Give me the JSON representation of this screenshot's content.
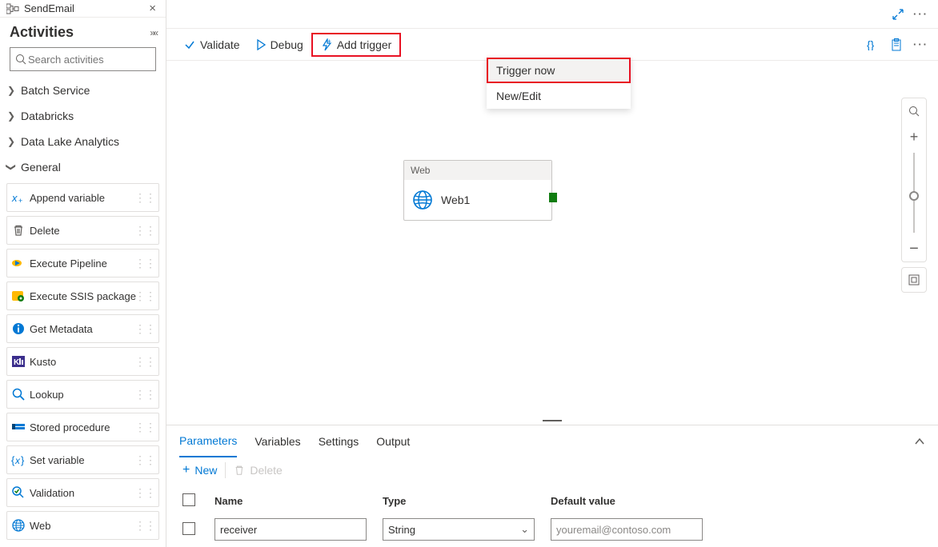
{
  "pipeline": {
    "name": "SendEmail"
  },
  "activities": {
    "title": "Activities",
    "search_placeholder": "Search activities",
    "categories": [
      {
        "label": "Batch Service",
        "expanded": false
      },
      {
        "label": "Databricks",
        "expanded": false
      },
      {
        "label": "Data Lake Analytics",
        "expanded": false
      },
      {
        "label": "General",
        "expanded": true
      }
    ],
    "general_items": [
      {
        "label": "Append variable",
        "icon": "append-var"
      },
      {
        "label": "Delete",
        "icon": "delete"
      },
      {
        "label": "Execute Pipeline",
        "icon": "exec-pipeline"
      },
      {
        "label": "Execute SSIS package",
        "icon": "ssis"
      },
      {
        "label": "Get Metadata",
        "icon": "metadata"
      },
      {
        "label": "Kusto",
        "icon": "kusto"
      },
      {
        "label": "Lookup",
        "icon": "lookup"
      },
      {
        "label": "Stored procedure",
        "icon": "sproc"
      },
      {
        "label": "Set variable",
        "icon": "set-var"
      },
      {
        "label": "Validation",
        "icon": "validation"
      },
      {
        "label": "Web",
        "icon": "web"
      }
    ]
  },
  "toolbar": {
    "validate": "Validate",
    "debug": "Debug",
    "add_trigger": "Add trigger",
    "menu": {
      "trigger_now": "Trigger now",
      "new_edit": "New/Edit"
    }
  },
  "canvas": {
    "node": {
      "type_label": "Web",
      "name": "Web1"
    }
  },
  "bottom": {
    "tabs": {
      "parameters": "Parameters",
      "variables": "Variables",
      "settings": "Settings",
      "output": "Output"
    },
    "toolbar": {
      "new": "New",
      "delete": "Delete"
    },
    "table": {
      "headers": {
        "name": "Name",
        "type": "Type",
        "default": "Default value"
      },
      "row": {
        "name": "receiver",
        "type": "String",
        "default": "youremail@contoso.com"
      }
    }
  }
}
